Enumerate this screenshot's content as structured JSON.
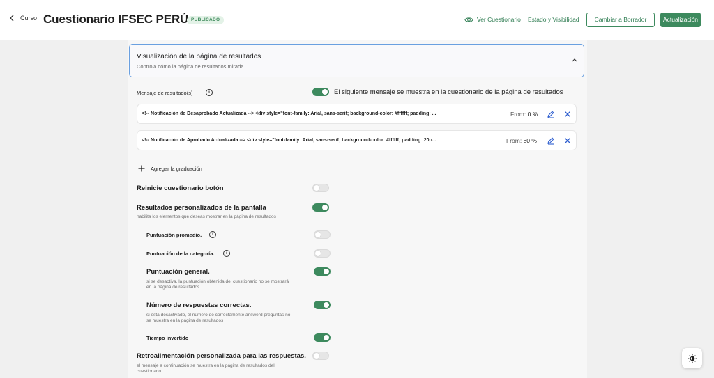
{
  "header": {
    "back_label": "Curso",
    "title": "Cuestionario IFSEC PERÚ",
    "status_badge": "PUBLICADO",
    "view_link": "Ver Cuestionario",
    "status_visibility_link": "Estado y Visibilidad",
    "draft_button": "Cambiar a Borrador",
    "update_button": "Actualización"
  },
  "section": {
    "title": "Visualización de la página de resultados",
    "subtitle": "Controla cómo la página de resultados mirada"
  },
  "result_messages": {
    "label": "Mensaje de resultado(s)",
    "toggle_on": true,
    "toggle_description": "El siguiente mensaje se muestra en la cuestionario de la página de resultados",
    "items": [
      {
        "text": "<!-- Notificación de Desaprobado Actualizada --> <div style=\"font-family: Arial, sans-serif; background-color: #ffffff; padding: ...",
        "from_label": "From:",
        "from_value": "0 %"
      },
      {
        "text": "<!-- Notificación de Aprobado Actualizada --> <div style=\"font-family: Arial, sans-serif; background-color: #ffffff; padding: 20p...",
        "from_label": "From:",
        "from_value": "80 %"
      }
    ],
    "add_label": "Agregar la graduación"
  },
  "settings": {
    "restart_button": {
      "label": "Reinicie cuestionario botón",
      "on": false
    },
    "custom_results": {
      "label": "Resultados personalizados de la pantalla",
      "description": "habilita los elementos que deseas mostrar en la página de resultados",
      "on": true
    },
    "average_score": {
      "label": "Puntuación promedio.",
      "on": false
    },
    "category_score": {
      "label": "Puntuación de la categoría.",
      "on": false
    },
    "general_score": {
      "label": "Puntuación general.",
      "description_line1": "si se desactiva, la puntuación obtenida del cuestionario no se mostrará",
      "description_line2": "en la página de resultados.",
      "on": true
    },
    "correct_answers": {
      "label": "Número de respuestas correctas.",
      "description_line1": "si está desactivado, el número de correctamente answerd preguntas no",
      "description_line2": "se muestra en la página de resultados",
      "on": true
    },
    "time_spent": {
      "label": "Tiempo invertido",
      "on": true
    },
    "custom_feedback": {
      "label": "Retroalimentación personalizada para las respuestas.",
      "description_line1": "el mensaje a continuación se muestra en la página de resultados del",
      "description_line2": "cuestionario.",
      "on": false
    }
  },
  "icons": {
    "back": "chevron-left-icon",
    "view": "eye-icon",
    "collapse": "chevron-up-icon",
    "info": "info-icon",
    "edit": "pencil-icon",
    "delete": "close-icon",
    "add": "plus-icon",
    "theme": "brightness-icon"
  },
  "colors": {
    "brand_green": "#3d8a5e",
    "accent_blue": "#2f5fcf",
    "focus_border": "#6aa0e0"
  }
}
